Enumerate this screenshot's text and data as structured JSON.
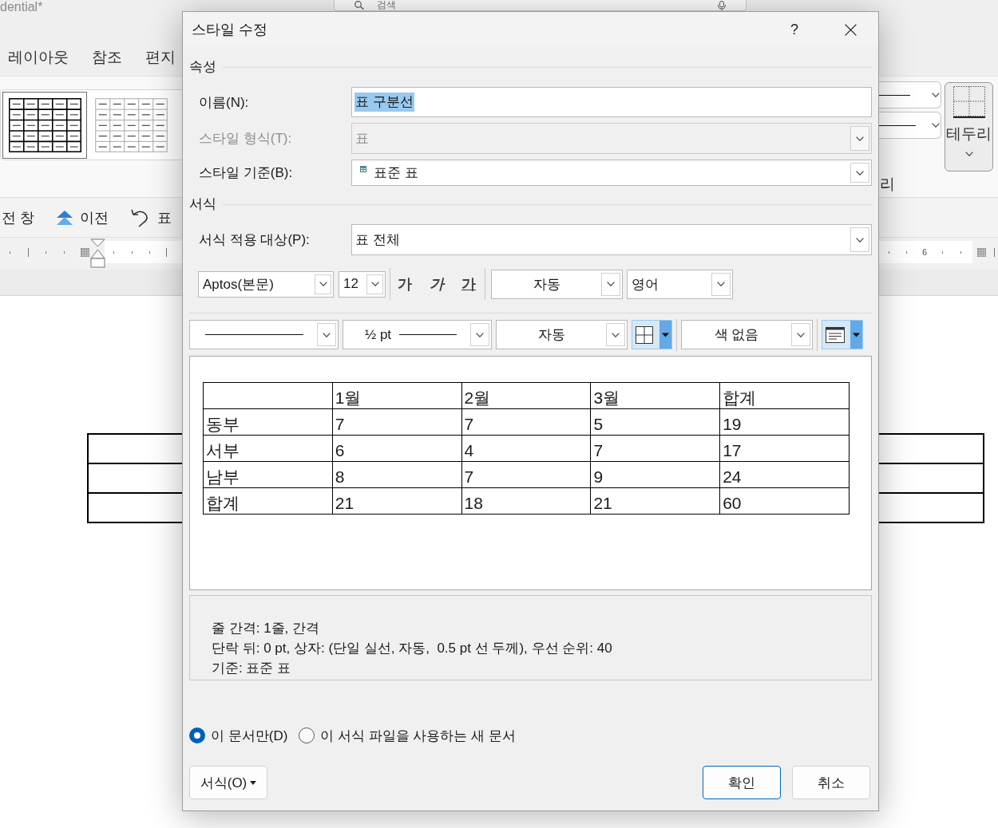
{
  "app": {
    "title": "dential*",
    "search": {
      "placeholder": "검색"
    }
  },
  "ribbon": {
    "tabs": [
      {
        "label": "레이아웃",
        "selected": false
      },
      {
        "label": "참조",
        "selected": false
      },
      {
        "label": "편지",
        "selected": false
      }
    ],
    "table_styles": [
      {
        "kind": "grid",
        "selected": true
      },
      {
        "kind": "light-grid",
        "selected": false
      }
    ],
    "borders_button": {
      "label": "테두리"
    },
    "cut_label": "리"
  },
  "navigation": [
    {
      "kind": "text",
      "label": "전 창"
    },
    {
      "kind": "previous",
      "label": "이전"
    },
    {
      "kind": "undo",
      "label": "표"
    }
  ],
  "ruler": {
    "number": "6"
  },
  "dialog": {
    "title": "스타일 수정",
    "help": "?",
    "properties": {
      "heading": "속성",
      "fields": [
        {
          "kind": "text",
          "label": "이름(N):",
          "value": "표 구분선",
          "value_selected": true,
          "disabled": false
        },
        {
          "kind": "dropdown",
          "label": "스타일 형식(T):",
          "value": "표",
          "value_selected": false,
          "disabled": true
        },
        {
          "kind": "style-dropdown",
          "label": "스타일 기준(B):",
          "value": "표준 표",
          "value_selected": false,
          "disabled": false
        }
      ]
    },
    "formatting": {
      "heading": "서식",
      "apply_to": {
        "label": "서식 적용 대상(P):",
        "value": "표 전체"
      },
      "font": {
        "name": "Aptos(본문)",
        "size": "12",
        "styles": [
          {
            "kind": "bold",
            "label": "가"
          },
          {
            "kind": "italic",
            "label": "가"
          },
          {
            "kind": "underline",
            "label": "가"
          }
        ],
        "tint": "자동",
        "language": "영어"
      },
      "borders": {
        "weight": "½ pt",
        "line_tint": "자동",
        "shading": "색 없음"
      }
    },
    "preview": {
      "columns": [
        "1월",
        "2월",
        "3월",
        "합계"
      ],
      "rows": [
        {
          "label": "동부",
          "values": [
            "7",
            "7",
            "5",
            "19"
          ]
        },
        {
          "label": "서부",
          "values": [
            "6",
            "4",
            "7",
            "17"
          ]
        },
        {
          "label": "남부",
          "values": [
            "8",
            "7",
            "9",
            "24"
          ]
        },
        {
          "label": "합계",
          "values": [
            "21",
            "18",
            "21",
            "60"
          ]
        }
      ]
    },
    "description": [
      "줄 간격: 1줄, 간격",
      "단락 뒤: 0 pt, 상자: (단일 실선, 자동,  0.5 pt 선 두께), 우선 순위: 40",
      "기준: 표준 표"
    ],
    "scope": [
      {
        "label": "이 문서만(D)",
        "selected": true
      },
      {
        "label": "이 서식 파일을 사용하는 새 문서",
        "selected": false
      }
    ],
    "buttons": [
      {
        "kind": "menu",
        "label": "서식(O)"
      },
      {
        "kind": "default",
        "label": "확인"
      },
      {
        "kind": "normal",
        "label": "취소"
      }
    ]
  }
}
